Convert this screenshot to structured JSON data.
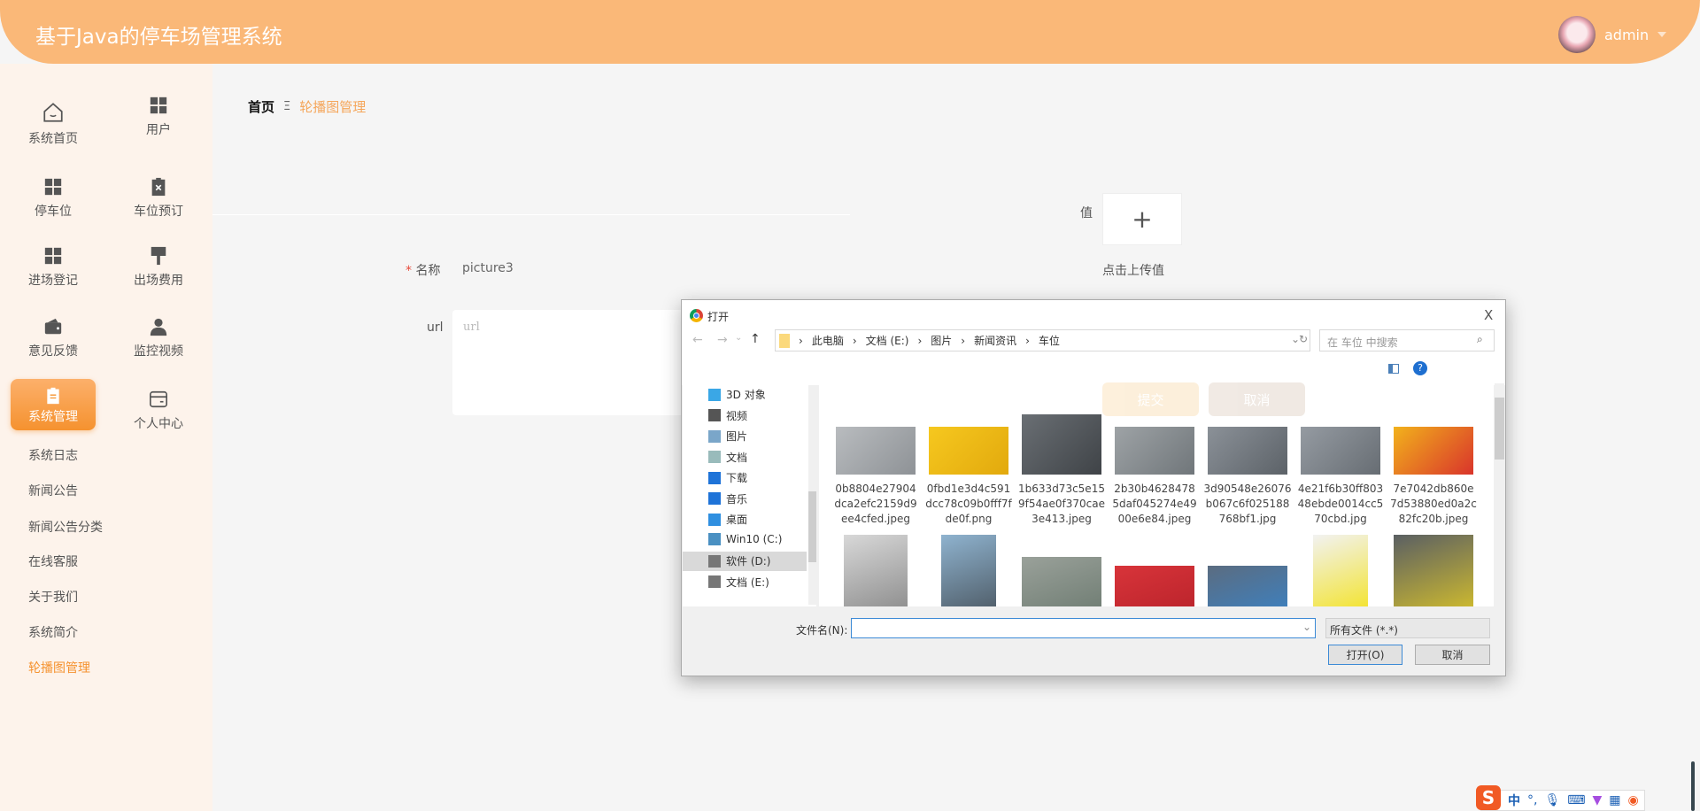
{
  "header": {
    "title": "基于Java的停车场管理系统",
    "username": "admin",
    "accent": "#fab878"
  },
  "sidebar": {
    "items": [
      {
        "label": "系统首页",
        "icon": "home-icon"
      },
      {
        "label": "用户",
        "icon": "grid-icon"
      },
      {
        "label": "停车位",
        "icon": "grid-icon"
      },
      {
        "label": "车位预订",
        "icon": "clipboard-x-icon"
      },
      {
        "label": "进场登记",
        "icon": "grid-icon"
      },
      {
        "label": "出场费用",
        "icon": "brush-icon"
      },
      {
        "label": "意见反馈",
        "icon": "wallet-icon"
      },
      {
        "label": "监控视频",
        "icon": "user-icon"
      },
      {
        "label": "系统管理",
        "icon": "clipboard-icon",
        "active": true
      },
      {
        "label": "个人中心",
        "icon": "card-icon"
      }
    ],
    "submenu": [
      "系统日志",
      "新闻公告",
      "新闻公告分类",
      "在线客服",
      "关于我们",
      "系统简介",
      "轮播图管理"
    ],
    "active_submenu": "轮播图管理"
  },
  "breadcrumb": {
    "home": "首页",
    "separator": "Ξ",
    "current": "轮播图管理"
  },
  "form": {
    "name_label": "名称",
    "required_mark": "*",
    "name_value": "picture3",
    "url_label": "url",
    "url_placeholder": "url",
    "value_label": "值",
    "upload_hint": "点击上传值",
    "upload_plus": "+",
    "submit": "提交",
    "cancel": "取消"
  },
  "dialog": {
    "title": "打开",
    "close": "X",
    "path": [
      "此电脑",
      "文档 (E:)",
      "图片",
      "新闻资讯",
      "车位"
    ],
    "search_placeholder": "在 车位 中搜索",
    "tree": [
      "3D 对象",
      "视频",
      "图片",
      "文档",
      "下载",
      "音乐",
      "桌面",
      "Win10 (C:)",
      "软件 (D:)",
      "文档 (E:)"
    ],
    "selected_tree": "文档 (E:)",
    "files": [
      {
        "name": [
          "0b8804e27904",
          "dca2efc2159d9",
          "ee4cfed.jpeg"
        ],
        "colors": [
          "#b9bcbf",
          "#8e9296"
        ]
      },
      {
        "name": [
          "0fbd1e3d4c591",
          "dcc78c09b0fff7f",
          "de0f.png"
        ],
        "colors": [
          "#f6c81f",
          "#e2a90d"
        ]
      },
      {
        "name": [
          "1b633d73c5e15",
          "9f54ae0f370cae",
          "3e413.jpeg"
        ],
        "colors": [
          "#6a6f74",
          "#3f4347"
        ]
      },
      {
        "name": [
          "2b30b4628478",
          "5daf045274e49",
          "00e6e84.jpeg"
        ],
        "colors": [
          "#9ea3a6",
          "#70767a"
        ]
      },
      {
        "name": [
          "3d90548e26076",
          "b067c6f025188",
          "768bf1.jpg"
        ],
        "colors": [
          "#8b9198",
          "#5c6268"
        ]
      },
      {
        "name": [
          "4e21f6b30ff803",
          "48ebde0014cc5",
          "70cbd.jpg"
        ],
        "colors": [
          "#959ba2",
          "#676d73"
        ]
      },
      {
        "name": [
          "7e7042db860e",
          "7d53880ed0a2c",
          "82fc20b.jpeg"
        ],
        "colors": [
          "#f2b21c",
          "#d9342b"
        ]
      }
    ],
    "files_row2": [
      {
        "colors": [
          "#d8d8d8",
          "#888888"
        ]
      },
      {
        "colors": [
          "#8fb3cf",
          "#4a5660"
        ]
      },
      {
        "colors": [
          "#9aa19a",
          "#6c7a70"
        ]
      },
      {
        "colors": [
          "#d8343a",
          "#b8222a"
        ]
      },
      {
        "colors": [
          "#5b6c80",
          "#3b82c4"
        ]
      },
      {
        "colors": [
          "#f2f2f2",
          "#f3e21c"
        ]
      },
      {
        "colors": [
          "#5a5f63",
          "#d8c22a"
        ]
      }
    ],
    "filename_label": "文件名(N):",
    "filename_value": "",
    "filter": "所有文件 (*.*)",
    "open": "打开(O)",
    "cancel": "取消"
  },
  "ime": {
    "lang": "中",
    "punct": "°,"
  }
}
